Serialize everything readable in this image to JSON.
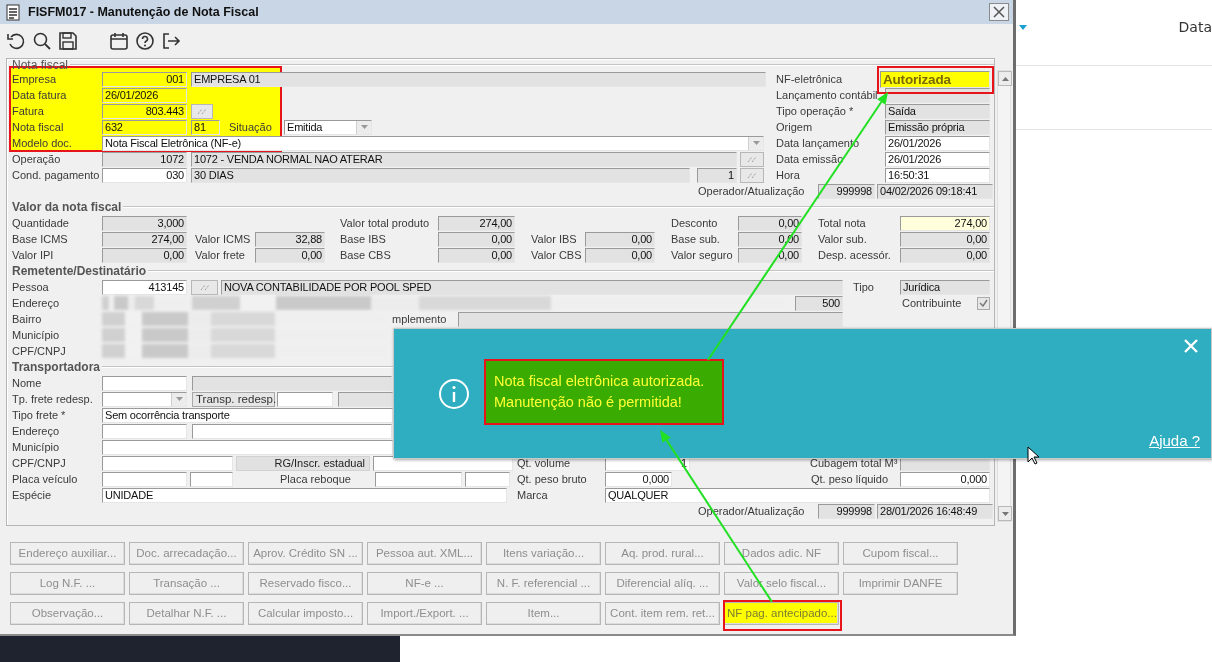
{
  "window": {
    "title": "FISFM017 - Manutenção de Nota Fiscal"
  },
  "toolbar": [
    {
      "kind": "undo"
    },
    {
      "kind": "search"
    },
    {
      "kind": "save"
    },
    {
      "kind": "calendar"
    },
    {
      "kind": "help"
    },
    {
      "kind": "exit"
    }
  ],
  "sections": [
    {
      "title": "Nota fiscal",
      "lines": [
        {
          "controls": [
            {
              "kind": "label",
              "text": "Empresa"
            },
            {
              "kind": "marked",
              "value": "001"
            },
            {
              "kind": "display",
              "value": "EMPRESA 01"
            },
            {
              "kind": "label",
              "text": "NF-eletrônica"
            },
            {
              "kind": "status",
              "value": "Autorizada"
            }
          ]
        },
        {
          "controls": [
            {
              "kind": "label",
              "text": "Data fatura"
            },
            {
              "kind": "marked",
              "value": "26/01/2026"
            },
            {
              "kind": "label",
              "text": "Lançamento contábil"
            },
            {
              "kind": "display"
            }
          ]
        },
        {
          "controls": [
            {
              "kind": "label",
              "text": "Fatura"
            },
            {
              "kind": "marked",
              "value": "803.443"
            },
            {
              "kind": "lookup"
            },
            {
              "kind": "label",
              "text": "Tipo operação *"
            },
            {
              "kind": "display",
              "value": "Saída"
            }
          ]
        },
        {
          "controls": [
            {
              "kind": "label",
              "text": "Nota fiscal"
            },
            {
              "kind": "marked",
              "value": "632"
            },
            {
              "kind": "marked",
              "value": "81"
            },
            {
              "kind": "label",
              "text": "Situação"
            },
            {
              "kind": "select",
              "value": "Emitida"
            },
            {
              "kind": "label",
              "text": "Origem"
            },
            {
              "kind": "display",
              "value": "Emissão própria"
            }
          ]
        },
        {
          "controls": [
            {
              "kind": "label",
              "text": "Modelo doc."
            },
            {
              "kind": "select",
              "value": "Nota Fiscal Eletrônica (NF-e)"
            },
            {
              "kind": "label",
              "text": "Data lançamento"
            },
            {
              "kind": "input",
              "value": "26/01/2026"
            }
          ]
        },
        {
          "controls": [
            {
              "kind": "label",
              "text": "Operação"
            },
            {
              "kind": "display",
              "value": "1072"
            },
            {
              "kind": "display",
              "value": "1072 - VENDA NORMAL NAO ATERAR"
            },
            {
              "kind": "lookup"
            },
            {
              "kind": "label",
              "text": "Data emissão"
            },
            {
              "kind": "input",
              "value": "26/01/2026"
            }
          ]
        },
        {
          "controls": [
            {
              "kind": "label",
              "text": "Cond. pagamento"
            },
            {
              "kind": "input",
              "value": "030"
            },
            {
              "kind": "display",
              "value": "30 DIAS"
            },
            {
              "kind": "display",
              "value": "1"
            },
            {
              "kind": "lookup"
            },
            {
              "kind": "label",
              "text": "Hora"
            },
            {
              "kind": "input",
              "value": "16:50:31"
            }
          ]
        },
        {
          "controls": [
            {
              "kind": "label",
              "text": "Operador/Atualização"
            },
            {
              "kind": "display",
              "value": "999998"
            },
            {
              "kind": "display",
              "value": "04/02/2026 09:18:41"
            }
          ]
        }
      ]
    },
    {
      "title": "Valor da nota fiscal",
      "lines": [
        {
          "controls": [
            {
              "kind": "label",
              "text": "Quantidade"
            },
            {
              "kind": "display",
              "value": "3,000"
            },
            {
              "kind": "label",
              "text": "Valor total produto"
            },
            {
              "kind": "display",
              "value": "274,00"
            },
            {
              "kind": "label",
              "text": "Desconto"
            },
            {
              "kind": "display",
              "value": "0,00"
            },
            {
              "kind": "label",
              "text": "Total nota"
            },
            {
              "kind": "total",
              "value": "274,00"
            }
          ]
        },
        {
          "controls": [
            {
              "kind": "label",
              "text": "Base ICMS"
            },
            {
              "kind": "display",
              "value": "274,00"
            },
            {
              "kind": "label",
              "text": "Valor ICMS"
            },
            {
              "kind": "display",
              "value": "32,88"
            },
            {
              "kind": "label",
              "text": "Base IBS"
            },
            {
              "kind": "display",
              "value": "0,00"
            },
            {
              "kind": "label",
              "text": "Valor IBS"
            },
            {
              "kind": "display",
              "value": "0,00"
            },
            {
              "kind": "label",
              "text": "Base sub."
            },
            {
              "kind": "display",
              "value": "0,00"
            },
            {
              "kind": "label",
              "text": "Valor sub."
            },
            {
              "kind": "display",
              "value": "0,00"
            }
          ]
        },
        {
          "controls": [
            {
              "kind": "label",
              "text": "Valor IPI"
            },
            {
              "kind": "display",
              "value": "0,00"
            },
            {
              "kind": "label",
              "text": "Valor frete"
            },
            {
              "kind": "display",
              "value": "0,00"
            },
            {
              "kind": "label",
              "text": "Base CBS"
            },
            {
              "kind": "display",
              "value": "0,00"
            },
            {
              "kind": "label",
              "text": "Valor CBS"
            },
            {
              "kind": "display",
              "value": "0,00"
            },
            {
              "kind": "label",
              "text": "Valor seguro"
            },
            {
              "kind": "display",
              "value": "0,00"
            },
            {
              "kind": "label",
              "text": "Desp. acessór."
            },
            {
              "kind": "display",
              "value": "0,00"
            }
          ]
        }
      ]
    },
    {
      "title": "Remetente/Destinatário",
      "lines": [
        {
          "controls": [
            {
              "kind": "label",
              "text": "Pessoa"
            },
            {
              "kind": "input",
              "value": "413145"
            },
            {
              "kind": "lookup"
            },
            {
              "kind": "display",
              "value": "NOVA CONTABILIDADE POR POOL SPED"
            },
            {
              "kind": "label",
              "text": "Tipo"
            },
            {
              "kind": "display",
              "value": "Jurídica"
            }
          ]
        },
        {
          "controls": [
            {
              "kind": "label",
              "text": "Endereço"
            },
            {
              "kind": "blurred"
            },
            {
              "kind": "blurred"
            },
            {
              "kind": "display",
              "value": "500"
            },
            {
              "kind": "label",
              "text": "Contribuinte"
            },
            {
              "kind": "check",
              "checked": true
            }
          ]
        },
        {
          "controls": [
            {
              "kind": "label",
              "text": "Bairro"
            },
            {
              "kind": "blurred"
            },
            {
              "kind": "label",
              "text": "mplemento"
            },
            {
              "kind": "display"
            }
          ]
        },
        {
          "controls": [
            {
              "kind": "label",
              "text": "Município"
            },
            {
              "kind": "blurred"
            }
          ]
        },
        {
          "controls": [
            {
              "kind": "label",
              "text": "CPF/CNPJ"
            },
            {
              "kind": "blurred"
            }
          ]
        }
      ]
    },
    {
      "title": "Transportadora",
      "lines": [
        {
          "controls": [
            {
              "kind": "label",
              "text": "Nome"
            },
            {
              "kind": "input"
            },
            {
              "kind": "display"
            }
          ]
        },
        {
          "controls": [
            {
              "kind": "label",
              "text": "Tp. frete redesp."
            },
            {
              "kind": "select"
            },
            {
              "kind": "button",
              "text": "Transp. redesp."
            },
            {
              "kind": "input"
            },
            {
              "kind": "display"
            }
          ]
        },
        {
          "controls": [
            {
              "kind": "label",
              "text": "Tipo frete *"
            },
            {
              "kind": "input",
              "value": "Sem ocorrência transporte"
            }
          ]
        },
        {
          "controls": [
            {
              "kind": "label",
              "text": "Endereço"
            },
            {
              "kind": "input"
            },
            {
              "kind": "input"
            }
          ]
        },
        {
          "controls": [
            {
              "kind": "label",
              "text": "Município"
            },
            {
              "kind": "input"
            }
          ]
        },
        {
          "controls": [
            {
              "kind": "label",
              "text": "CPF/CNPJ"
            },
            {
              "kind": "input"
            },
            {
              "kind": "caption",
              "text": "RG/Inscr. estadual"
            },
            {
              "kind": "input"
            },
            {
              "kind": "label",
              "text": "Qt. volume"
            },
            {
              "kind": "input",
              "value": "1"
            },
            {
              "kind": "label",
              "text": "Cubagem total M³"
            },
            {
              "kind": "display"
            }
          ]
        },
        {
          "controls": [
            {
              "kind": "label",
              "text": "Placa veículo"
            },
            {
              "kind": "input"
            },
            {
              "kind": "input"
            },
            {
              "kind": "label",
              "text": "Placa reboque"
            },
            {
              "kind": "input"
            },
            {
              "kind": "input"
            },
            {
              "kind": "label",
              "text": "Qt. peso bruto"
            },
            {
              "kind": "input",
              "value": "0,000"
            },
            {
              "kind": "label",
              "text": "Qt. peso líquido"
            },
            {
              "kind": "input",
              "value": "0,000"
            }
          ]
        },
        {
          "controls": [
            {
              "kind": "label",
              "text": "Espécie"
            },
            {
              "kind": "input",
              "value": "UNIDADE"
            },
            {
              "kind": "label",
              "text": "Marca"
            },
            {
              "kind": "input",
              "value": "QUALQUER"
            }
          ]
        },
        {
          "controls": [
            {
              "kind": "label",
              "text": "Operador/Atualização"
            },
            {
              "kind": "display",
              "value": "999998"
            },
            {
              "kind": "display",
              "value": "28/01/2026 16:48:49"
            }
          ]
        }
      ]
    }
  ],
  "buttons": [
    {
      "label": "Endereço auxiliar...",
      "disabled": true,
      "highlighted": false
    },
    {
      "label": "Doc. arrecadação...",
      "disabled": true,
      "highlighted": false
    },
    {
      "label": "Aprov. Crédito SN ...",
      "disabled": true,
      "highlighted": false
    },
    {
      "label": "Pessoa aut. XML...",
      "disabled": true,
      "highlighted": false
    },
    {
      "label": "Itens variação...",
      "disabled": true,
      "highlighted": false
    },
    {
      "label": "Aq. prod. rural...",
      "disabled": true,
      "highlighted": false
    },
    {
      "label": "Dados adic. NF",
      "disabled": true,
      "highlighted": false
    },
    {
      "label": "Cupom fiscal...",
      "disabled": true,
      "highlighted": false
    },
    {
      "label": "Log N.F. ...",
      "disabled": true,
      "highlighted": false
    },
    {
      "label": "Transação ...",
      "disabled": true,
      "highlighted": false
    },
    {
      "label": "Reservado fisco...",
      "disabled": true,
      "highlighted": false
    },
    {
      "label": "NF-e ...",
      "disabled": true,
      "highlighted": false
    },
    {
      "label": "N. F. referencial ...",
      "disabled": true,
      "highlighted": false
    },
    {
      "label": "Diferencial alíq. ...",
      "disabled": true,
      "highlighted": false
    },
    {
      "label": "Valor selo fiscal...",
      "disabled": true,
      "highlighted": false
    },
    {
      "label": "Imprimir DANFE",
      "disabled": true,
      "highlighted": false
    },
    {
      "label": "Observação...",
      "disabled": true,
      "highlighted": false
    },
    {
      "label": "Detalhar N.F. ...",
      "disabled": true,
      "highlighted": false
    },
    {
      "label": "Calcular imposto...",
      "disabled": true,
      "highlighted": false
    },
    {
      "label": "Import./Export. ...",
      "disabled": true,
      "highlighted": false
    },
    {
      "label": "Item...",
      "disabled": true,
      "highlighted": false
    },
    {
      "label": "Cont. item rem. ret...",
      "disabled": true,
      "highlighted": false
    },
    {
      "label": "NF pag. antecipado...",
      "disabled": true,
      "highlighted": true
    }
  ],
  "popup": {
    "message_lines": [
      "Nota fiscal eletrônica autorizada.",
      "Manutenção não é permitida!"
    ],
    "highlighted": true,
    "help_link": "Ajuda ?"
  },
  "background_page": {
    "column_header": "Data"
  },
  "annotations": [
    {
      "kind": "highlight"
    },
    {
      "kind": "frame"
    },
    {
      "kind": "frame"
    },
    {
      "kind": "frame"
    },
    {
      "kind": "arrow"
    },
    {
      "kind": "arrow"
    }
  ]
}
